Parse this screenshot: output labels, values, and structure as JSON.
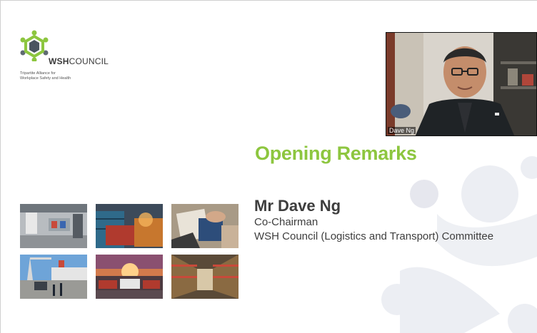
{
  "logo": {
    "name_bold": "WSH",
    "name_rest": "COUNCIL",
    "tagline_line1": "Tripartite Alliance for",
    "tagline_line2": "Workplace Safety and Health"
  },
  "video": {
    "participant_name": "Dave Ng"
  },
  "slide": {
    "title": "Opening Remarks",
    "speaker_name": "Mr Dave Ng",
    "speaker_role": "Co-Chairman",
    "speaker_committee": "WSH Council (Logistics and Transport) Committee"
  },
  "colors": {
    "title_green": "#8dc63f",
    "text_dark": "#3d3d3d",
    "deco_grey": "#e9eaef"
  },
  "photos": [
    {
      "icon": "warehouse-dock-photo"
    },
    {
      "icon": "shipping-containers-photo"
    },
    {
      "icon": "documents-handshake-photo"
    },
    {
      "icon": "port-cranes-photo"
    },
    {
      "icon": "container-trucks-sunset-photo"
    },
    {
      "icon": "warehouse-shelves-photo"
    }
  ]
}
